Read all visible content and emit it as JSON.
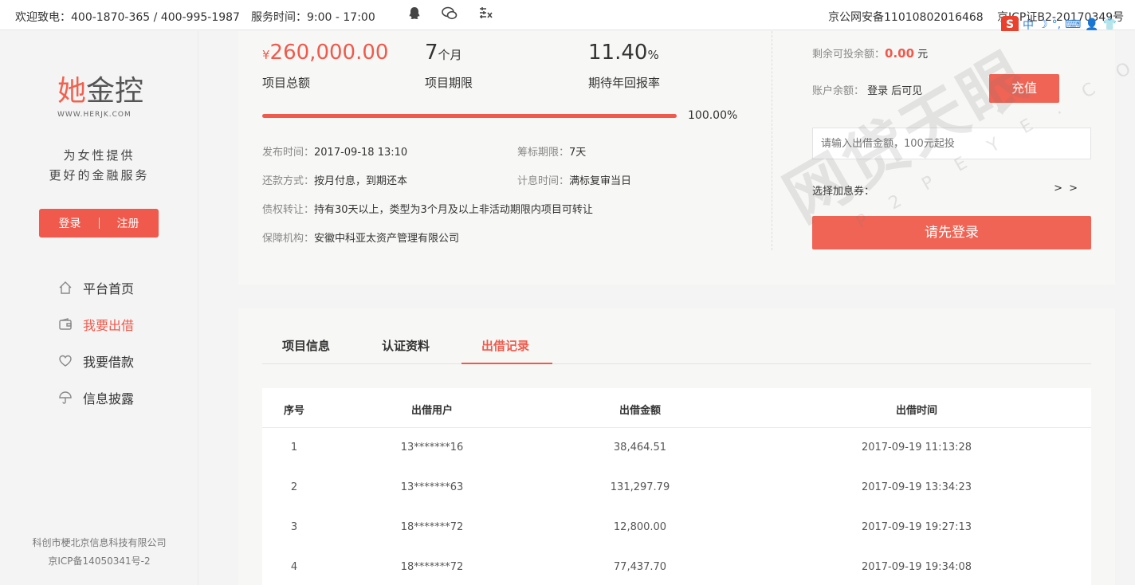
{
  "topbar": {
    "hotline": "欢迎致电：400-1870-365 / 400-995-1987",
    "service_hours": "服务时间：9:00 - 17:00",
    "icons": [
      "qq-icon",
      "wechat-icon",
      "weibo-icon"
    ],
    "police_record": "京公网安备11010802016468",
    "icp_record": "京ICP证B2-20170349号",
    "ime_labels": [
      "中",
      "☽",
      "°,",
      "⌨",
      "👤",
      "👕"
    ]
  },
  "sidebar": {
    "logo_text_red": "她",
    "logo_text_rest": "金控",
    "logo_url": "WWW.HERJK.COM",
    "slogan_line1": "为女性提供",
    "slogan_line2": "更好的金融服务",
    "login_label": "登录",
    "register_label": "注册",
    "nav": [
      {
        "label": "平台首页",
        "icon": "home-icon",
        "active": false
      },
      {
        "label": "我要出借",
        "icon": "wallet-icon",
        "active": true
      },
      {
        "label": "我要借款",
        "icon": "heart-icon",
        "active": false
      },
      {
        "label": "信息披露",
        "icon": "umbrella-icon",
        "active": false
      }
    ],
    "company": "科创市梗北京信息科技有限公司",
    "icp": "京ICP备14050341号-2"
  },
  "project": {
    "amount_prefix": "¥",
    "amount": "260,000.00",
    "amount_label": "项目总额",
    "term_value": "7",
    "term_unit": "个月",
    "term_label": "项目期限",
    "rate_value": "11.40",
    "rate_unit": "%",
    "rate_label": "期待年回报率",
    "progress_fraction": 1.0,
    "progress_text": "100.00%",
    "publish_key": "发布时间：",
    "publish_val": "2017-09-18 13:10",
    "raise_key": "筹标期限：",
    "raise_val": "7天",
    "repay_key": "还款方式：",
    "repay_val": "按月付息，到期还本",
    "interest_key": "计息时间：",
    "interest_val": "满标复审当日",
    "transfer_key": "债权转让：",
    "transfer_val": "持有30天以上，类型为3个月及以上非活动期限内项目可转让",
    "guarantee_key": "保障机构：",
    "guarantee_val": "安徽中科亚太资产管理有限公司"
  },
  "invest": {
    "remaining_key": "剩余可投余额：",
    "remaining_val": "0.00",
    "remaining_unit": "元",
    "balance_key": "账户余额：",
    "balance_val": "登录 后可见",
    "recharge_label": "充值",
    "amount_placeholder": "请输入出借金额，100元起投",
    "coupon_label": "选择加息券：",
    "coupon_arrow": "> >",
    "login_first_label": "请先登录"
  },
  "tabs": [
    "项目信息",
    "认证资料",
    "出借记录"
  ],
  "active_tab": 2,
  "records": {
    "headers": [
      "序号",
      "出借用户",
      "出借金额",
      "出借时间"
    ],
    "rows": [
      [
        "1",
        "13*******16",
        "38,464.51",
        "2017-09-19 11:13:28"
      ],
      [
        "2",
        "13*******63",
        "131,297.79",
        "2017-09-19 13:34:23"
      ],
      [
        "3",
        "18*******72",
        "12,800.00",
        "2017-09-19 19:27:13"
      ],
      [
        "4",
        "18*******72",
        "77,437.70",
        "2017-09-19 19:34:08"
      ]
    ]
  },
  "watermark": {
    "main": "网贷天眼",
    "sub": "P2PEYE.COM"
  },
  "colors": {
    "accent": "#ef5a4c",
    "panel": "#f7f7f5",
    "page": "#f4f4f4"
  }
}
